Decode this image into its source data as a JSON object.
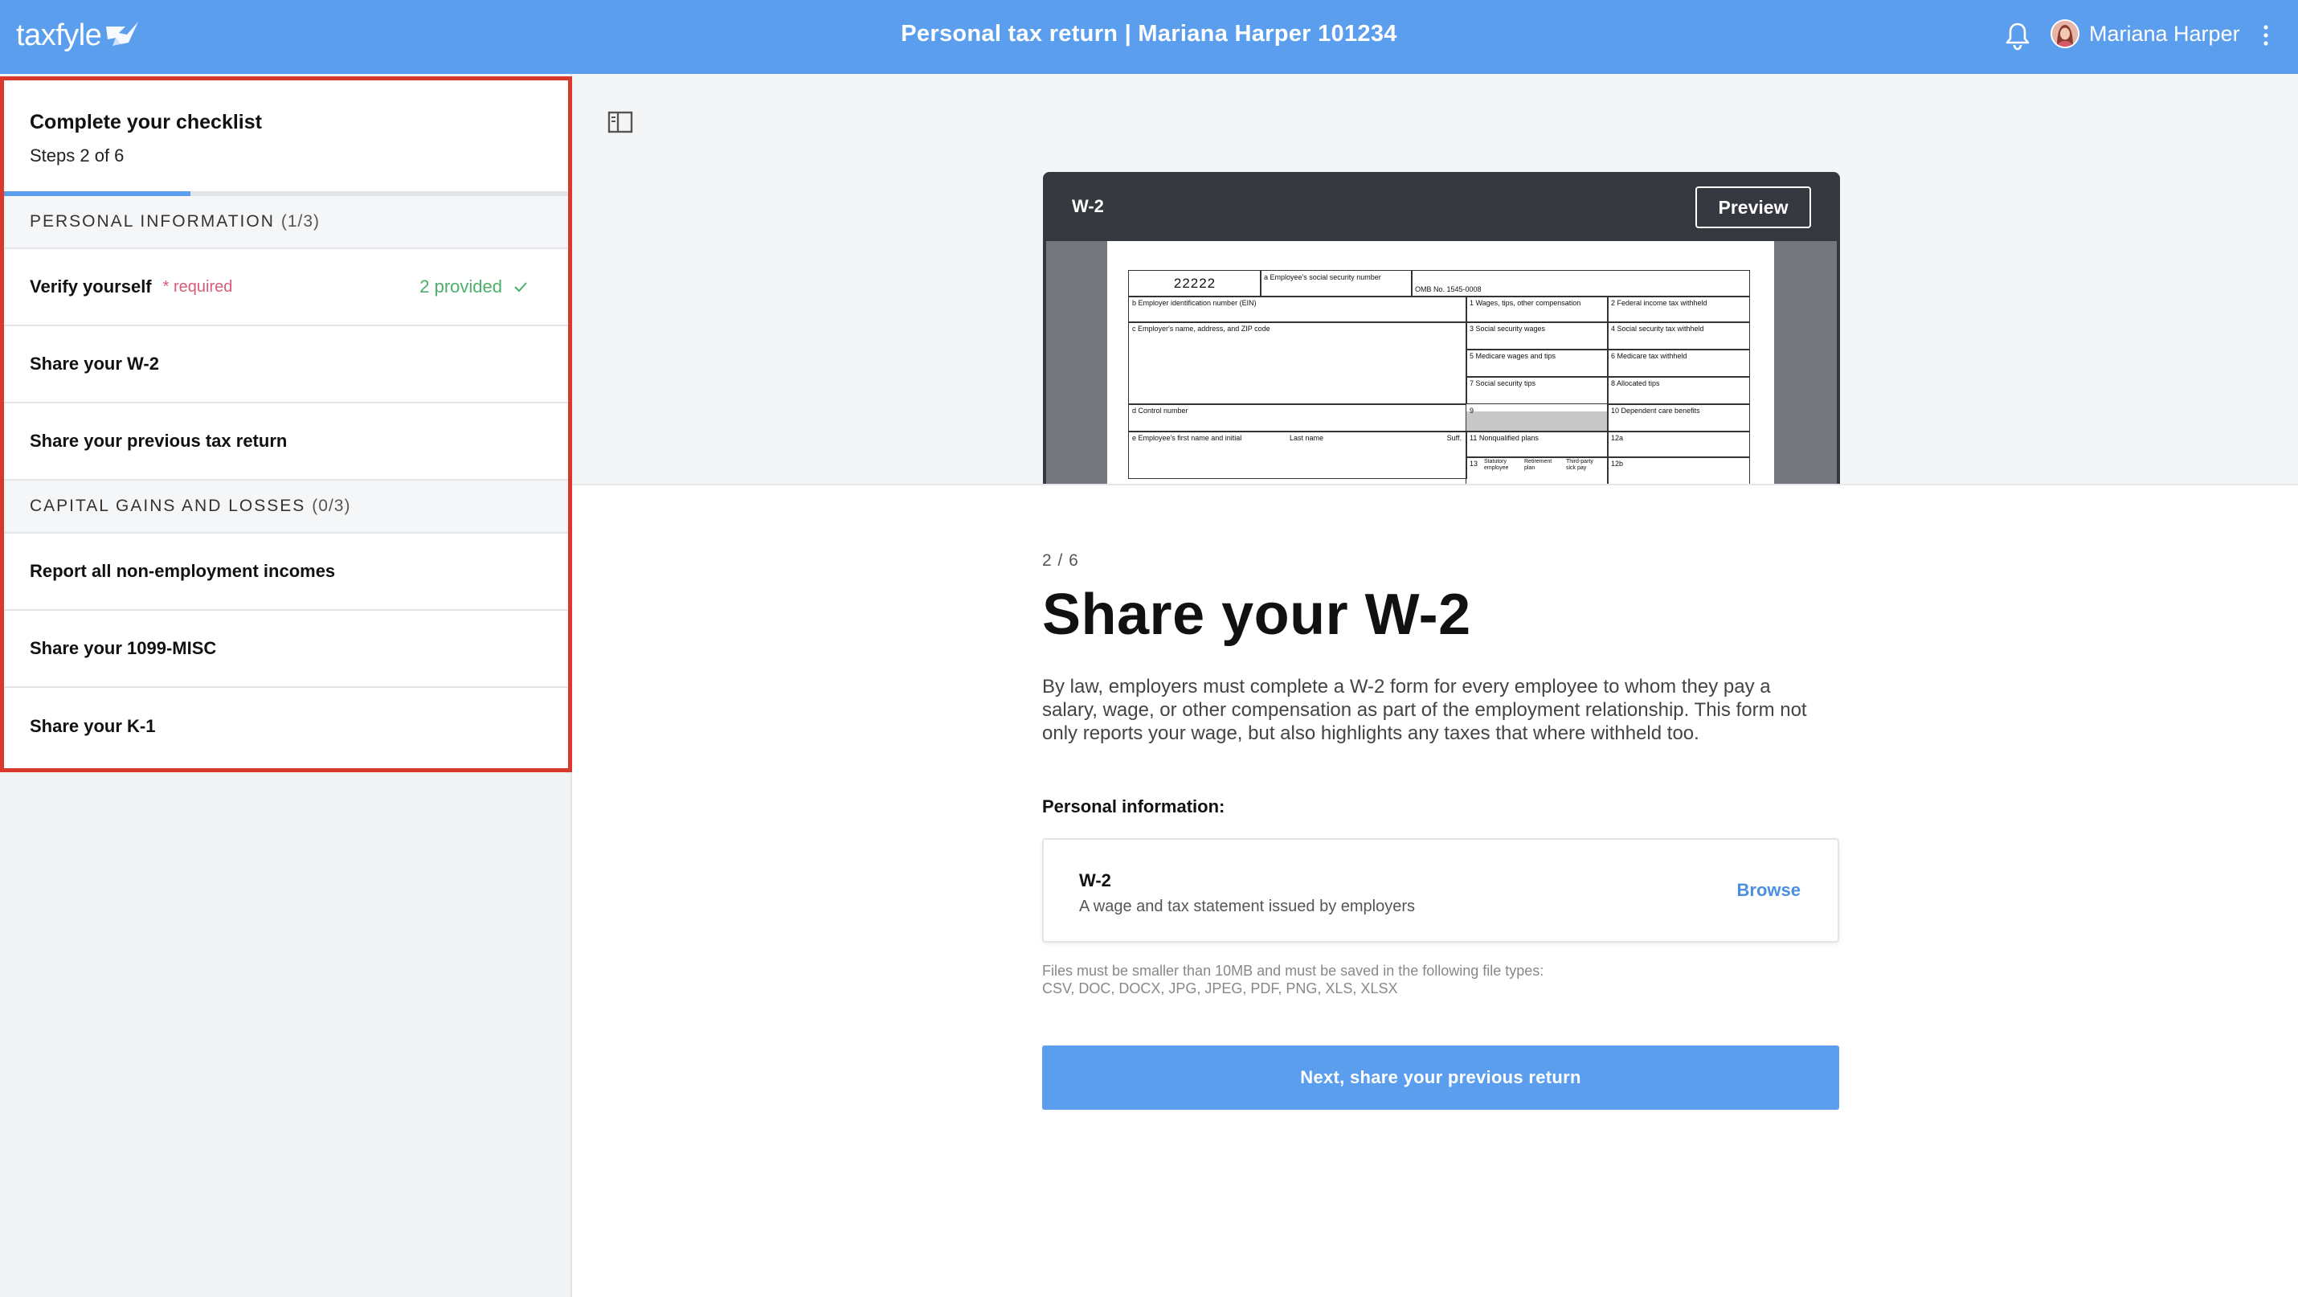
{
  "topbar": {
    "logo_text": "taxfyle",
    "title": "Personal tax return | Mariana Harper 101234",
    "user_name": "Mariana Harper"
  },
  "checklist": {
    "title": "Complete your checklist",
    "steps": "Steps 2 of 6",
    "progress_fraction": 0.33,
    "sections": [
      {
        "label": "PERSONAL INFORMATION",
        "count": "(1/3)",
        "items": [
          {
            "label": "Verify yourself",
            "required": "* required",
            "status": "2 provided"
          },
          {
            "label": "Share your W-2"
          },
          {
            "label": "Share your previous tax return"
          }
        ]
      },
      {
        "label": "CAPITAL GAINS AND LOSSES",
        "count": "(0/3)",
        "items": [
          {
            "label": "Report all non-employment incomes"
          },
          {
            "label": "Share your 1099-MISC"
          },
          {
            "label": "Share your K-1"
          }
        ]
      }
    ]
  },
  "document_preview": {
    "label": "W-2",
    "preview_button": "Preview",
    "form": {
      "code": "22222",
      "ssn": "a  Employee's social security number",
      "omb": "OMB No. 1545-0008",
      "ein": "b  Employer identification number (EIN)",
      "employer": "c  Employer's name, address, and ZIP code",
      "control": "d  Control number",
      "employee": "e  Employee's first name and initial",
      "last_name": "Last name",
      "suff": "Suff.",
      "box1": "1   Wages, tips, other compensation",
      "box2": "2   Federal income tax withheld",
      "box3": "3   Social security wages",
      "box4": "4   Social security tax withheld",
      "box5": "5   Medicare wages and tips",
      "box6": "6   Medicare tax withheld",
      "box7": "7   Social security tips",
      "box8": "8   Allocated tips",
      "box9": "9",
      "box10": "10   Dependent care benefits",
      "box11": "11   Nonqualified plans",
      "box12a": "12a",
      "box12b": "12b",
      "box13": "13",
      "stat": "Statutory employee",
      "retire": "Retirement plan",
      "third": "Third-party sick pay"
    }
  },
  "main": {
    "step_count": "2 / 6",
    "title": "Share your W-2",
    "intro": "By law, employers must complete a W-2 form for every employee to whom they pay a salary, wage, or other compensation as part of the employment relationship. This form not only reports your wage, but also highlights any taxes that where withheld too.",
    "section_label": "Personal information:",
    "upload": {
      "name": "W-2",
      "description": "A wage and tax statement issued by employers",
      "browse": "Browse"
    },
    "file_note_line1": "Files must be smaller than 10MB and must be saved in the following file types:",
    "file_note_line2": "CSV, DOC, DOCX, JPG, JPEG, PDF, PNG, XLS, XLSX",
    "next_button": "Next, share your previous return"
  }
}
